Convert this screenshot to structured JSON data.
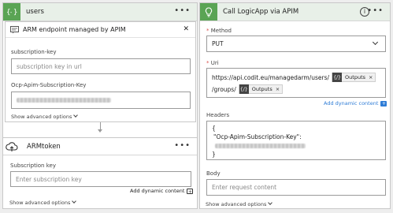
{
  "users_card": {
    "title": "users",
    "menu": "•••"
  },
  "endpoint_card": {
    "title": "ARM endpoint managed by APIM",
    "close": "✕",
    "fields": [
      {
        "label": "subscription-key",
        "placeholder": "subscription key in url"
      },
      {
        "label": "Ocp-Apim-Subscription-Key",
        "value": ""
      }
    ],
    "show_advanced": "Show advanced options"
  },
  "armtoken_card": {
    "title": "ARMtoken",
    "menu": "•••",
    "subscription_label": "Subscription key",
    "subscription_placeholder": "Enter subscription key",
    "add_dynamic": "Add dynamic content",
    "show_advanced": "Show advanced options"
  },
  "logicapp_card": {
    "title": "Call LogicApp via APIM",
    "info": "i",
    "menu": "•••",
    "method_label": "Method",
    "method_value": "PUT",
    "uri_label": "Uri",
    "uri_line1_text": "https://api.codit.eu/managedarm/users/",
    "uri_line2_text": "/groups/",
    "token_label": "Outputs",
    "token_close": "×",
    "add_dynamic": "Add dynamic content",
    "headers_label": "Headers",
    "headers_open": "{",
    "headers_key": "\"Ocp-Apim-Subscription-Key\":",
    "headers_close": "}",
    "body_label": "Body",
    "body_placeholder": "Enter request content",
    "show_advanced": "Show advanced options",
    "required_marker": "*"
  },
  "colors": {
    "green_accent": "#5aa454",
    "link_blue": "#2e7cd6",
    "required_red": "#d9534f"
  }
}
